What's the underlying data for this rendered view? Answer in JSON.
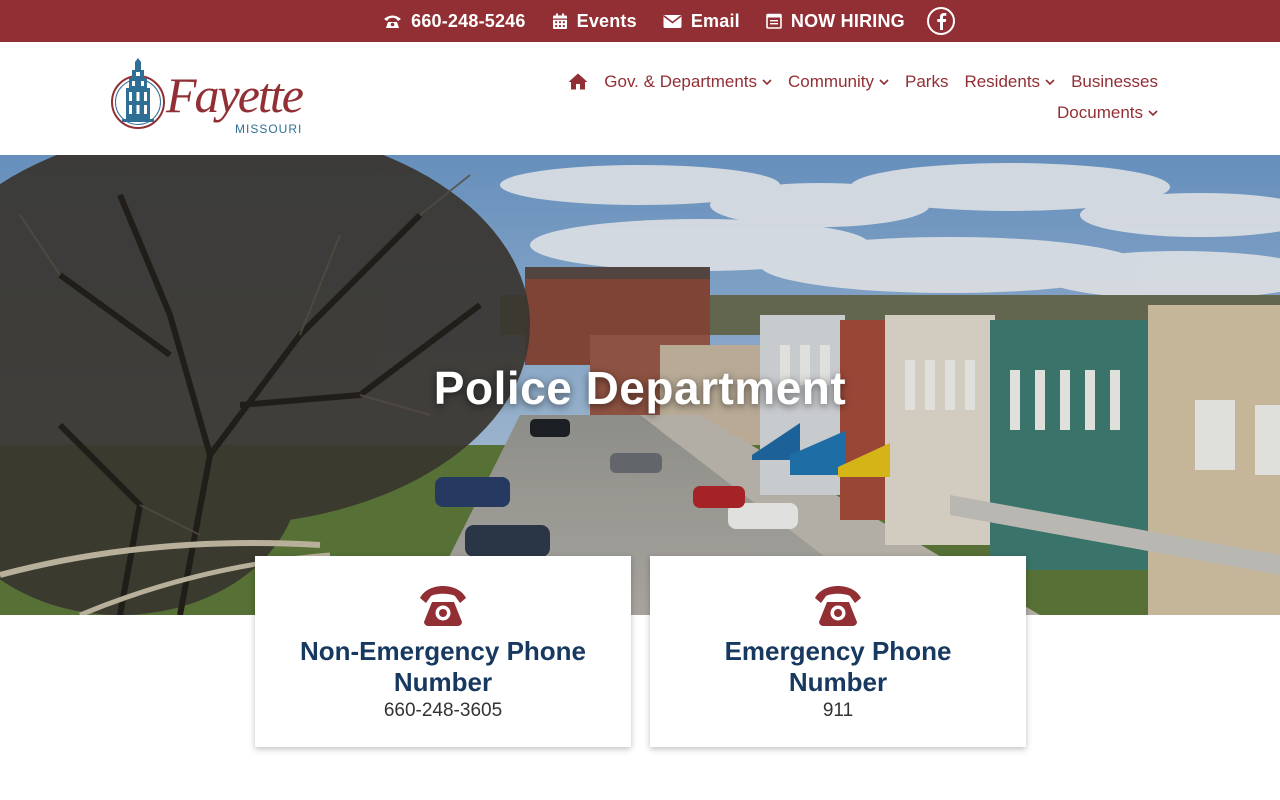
{
  "colors": {
    "brand": "#912f35",
    "navy": "#17385f",
    "logo_blue": "#2f6f96"
  },
  "topbar": {
    "phone": "660-248-5246",
    "events": "Events",
    "email": "Email",
    "hiring": "NOW HIRING",
    "social_icon": "facebook-icon"
  },
  "logo": {
    "word": "Fayette",
    "sub": "MISSOURI"
  },
  "nav": {
    "home_icon": "home-icon",
    "items": [
      {
        "label": "Gov. & Departments",
        "dropdown": true
      },
      {
        "label": "Community",
        "dropdown": true
      },
      {
        "label": "Parks",
        "dropdown": false
      },
      {
        "label": "Residents",
        "dropdown": true
      },
      {
        "label": "Businesses",
        "dropdown": false
      },
      {
        "label": "Documents",
        "dropdown": true
      }
    ]
  },
  "hero": {
    "title": "Police Department"
  },
  "cards": [
    {
      "title": "Non-Emergency Phone Number",
      "value": "660-248-3605",
      "icon": "telephone-icon"
    },
    {
      "title": "Emergency Phone Number",
      "value": "911",
      "icon": "telephone-icon"
    }
  ]
}
